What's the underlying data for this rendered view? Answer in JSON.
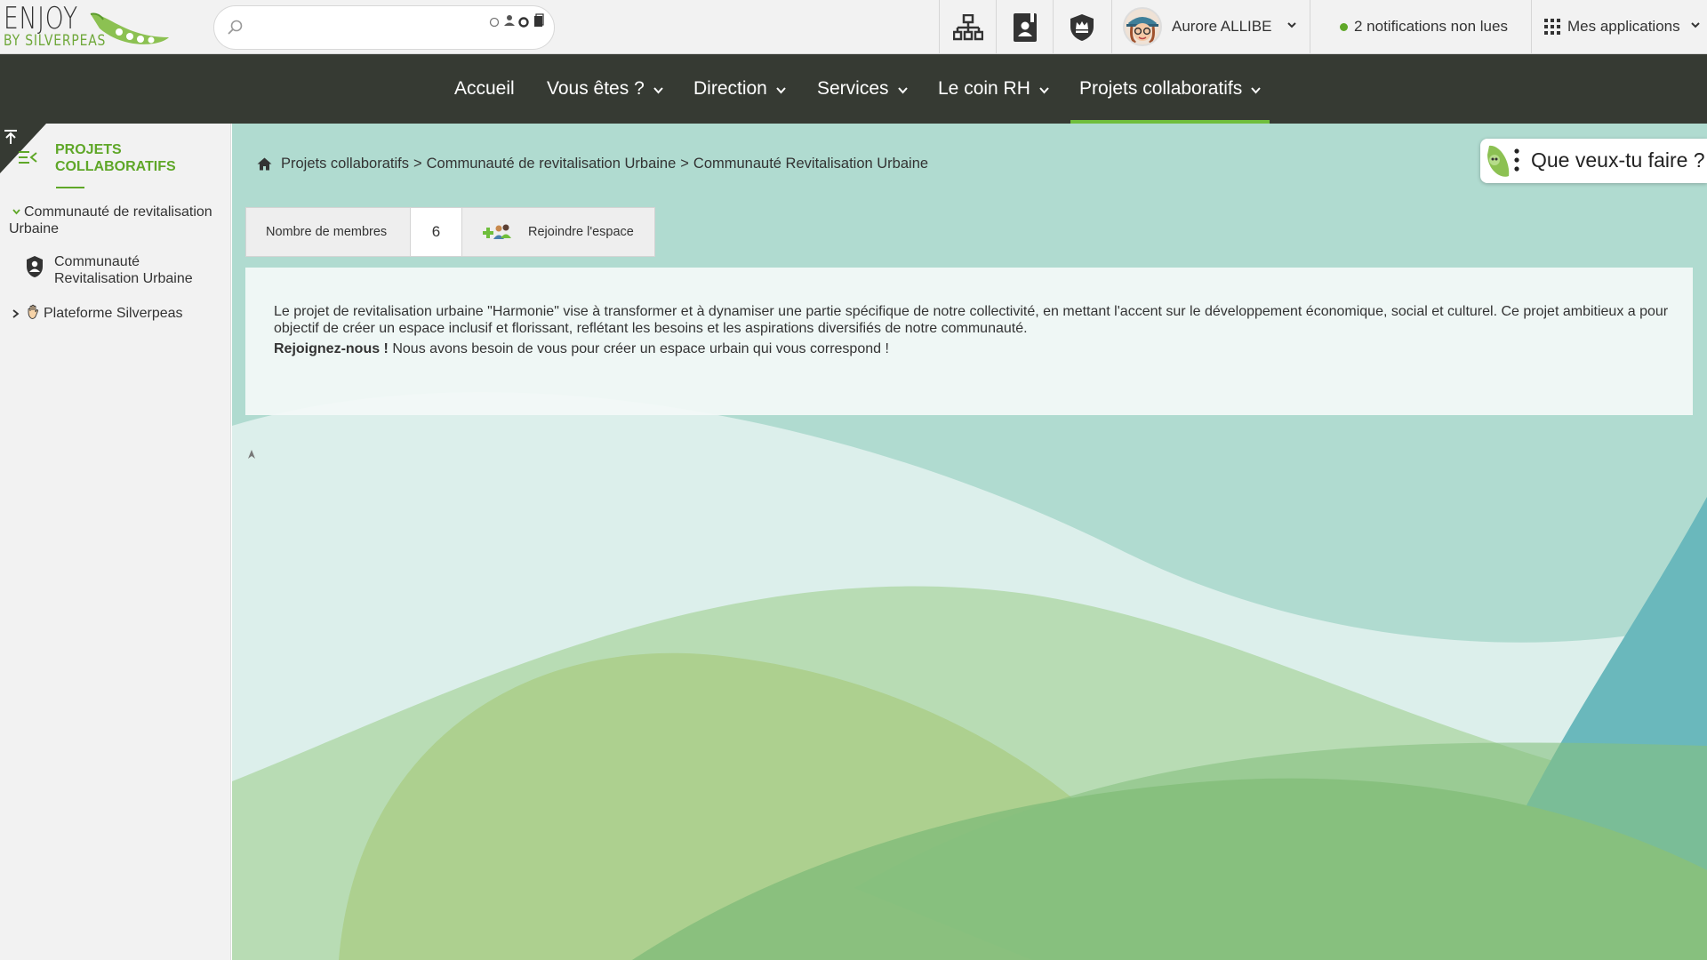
{
  "logo": {
    "line1": "ENJOY",
    "line2": "BY SILVERPEAS"
  },
  "search": {
    "value": "",
    "placeholder": ""
  },
  "header_icons": [
    "sitemap-icon",
    "directory-icon",
    "admin-shield-icon"
  ],
  "user": {
    "name": "Aurore ALLIBE"
  },
  "notifications": {
    "text": "2 notifications non lues",
    "status_color": "#5fa728"
  },
  "apps": {
    "label": "Mes applications"
  },
  "nav": {
    "items": [
      {
        "label": "Accueil",
        "has_menu": false,
        "active": false
      },
      {
        "label": "Vous êtes ?",
        "has_menu": true,
        "active": false
      },
      {
        "label": "Direction",
        "has_menu": true,
        "active": false
      },
      {
        "label": "Services",
        "has_menu": true,
        "active": false
      },
      {
        "label": "Le coin RH",
        "has_menu": true,
        "active": false
      },
      {
        "label": "Projets collaboratifs",
        "has_menu": true,
        "active": true
      }
    ]
  },
  "sidebar": {
    "title_line1": "PROJETS",
    "title_line2": "COLLABORATIFS",
    "tree": [
      {
        "label_line1": "Communauté de revitalisation",
        "label_line2": "Urbaine",
        "expanded": true
      },
      {
        "label_line1": "Communauté",
        "label_line2": "Revitalisation Urbaine",
        "icon": "community-icon"
      },
      {
        "label": "Plateforme Silverpeas",
        "expanded": false,
        "icon": "hand-icon"
      }
    ]
  },
  "breadcrumb": {
    "items": [
      "Projets collaboratifs",
      "Communauté de revitalisation Urbaine",
      "Communauté Revitalisation Urbaine"
    ],
    "separator": ">"
  },
  "space": {
    "members_label": "Nombre de membres",
    "members_count": "6",
    "join_label": "Rejoindre l'espace"
  },
  "description": {
    "paragraph1": "Le projet de revitalisation urbaine \"Harmonie\" vise à transformer et à dynamiser une partie spécifique de notre collectivité, en mettant l'accent sur le développement économique, social et culturel. Ce projet ambitieux a pour objectif de créer un espace inclusif et florissant, reflétant les besoins et les aspirations diversifiés de notre communauté.",
    "paragraph2_strong": "Rejoignez-nous !",
    "paragraph2_rest": " Nous avons besoin de vous pour créer un espace urbain qui vous correspond !"
  },
  "assistant": {
    "label": "Que veux-tu faire ?"
  },
  "colors": {
    "accent": "#6fbe3c",
    "nav_bg": "#363a33",
    "brand_green": "#5fa728"
  }
}
